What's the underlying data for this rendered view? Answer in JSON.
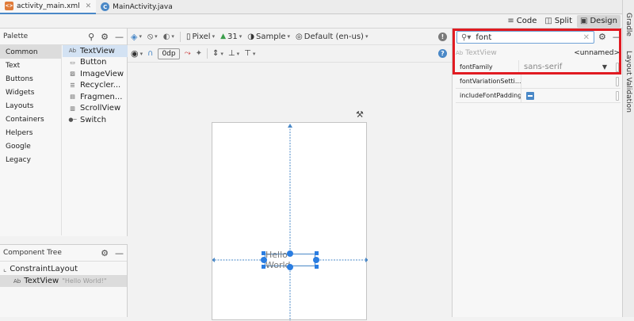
{
  "file_tabs": [
    {
      "label": "activity_main.xml",
      "icon": "xml-file-icon",
      "active": true
    },
    {
      "label": "MainActivity.java",
      "icon": "java-class-icon",
      "active": false
    }
  ],
  "view_modes": [
    {
      "label": "Code",
      "icon": "code-view-icon",
      "active": false
    },
    {
      "label": "Split",
      "icon": "split-view-icon",
      "active": false
    },
    {
      "label": "Design",
      "icon": "design-view-icon",
      "active": true
    }
  ],
  "side_tools": {
    "gradle": "Gradle",
    "layout_validation": "Layout Validation"
  },
  "palette": {
    "title": "Palette",
    "categories": [
      "Common",
      "Text",
      "Buttons",
      "Widgets",
      "Layouts",
      "Containers",
      "Helpers",
      "Google",
      "Legacy"
    ],
    "active_category": "Common",
    "items": [
      {
        "icon_text": "Ab",
        "label": "TextView"
      },
      {
        "icon_text": "",
        "label": "Button"
      },
      {
        "icon_text": "",
        "label": "ImageView"
      },
      {
        "icon_text": "",
        "label": "Recycler..."
      },
      {
        "icon_text": "",
        "label": "Fragmen..."
      },
      {
        "icon_text": "",
        "label": "ScrollView"
      },
      {
        "icon_text": "",
        "label": "Switch"
      }
    ]
  },
  "component_tree": {
    "title": "Component Tree",
    "root": "ConstraintLayout",
    "child": {
      "icon_text": "Ab",
      "label": "TextView",
      "hint": "\"Hello World!\""
    }
  },
  "design_toolbar": {
    "device": "Pixel",
    "api": "31",
    "theme": "Sample",
    "locale": "Default (en-us)",
    "margin": "0dp"
  },
  "canvas": {
    "text_preview": "Hello World"
  },
  "attributes": {
    "search_value": "font",
    "component_type_icon": "Ab",
    "component_type": "TextView",
    "component_id": "<unnamed>",
    "rows": [
      {
        "name": "fontFamily",
        "value": "sans-serif"
      },
      {
        "name": "fontVariationSetti...",
        "value": ""
      },
      {
        "name": "includeFontPadding",
        "value": ""
      }
    ]
  },
  "colors": {
    "accent": "#4a88c7",
    "highlight": "#e11b22"
  }
}
